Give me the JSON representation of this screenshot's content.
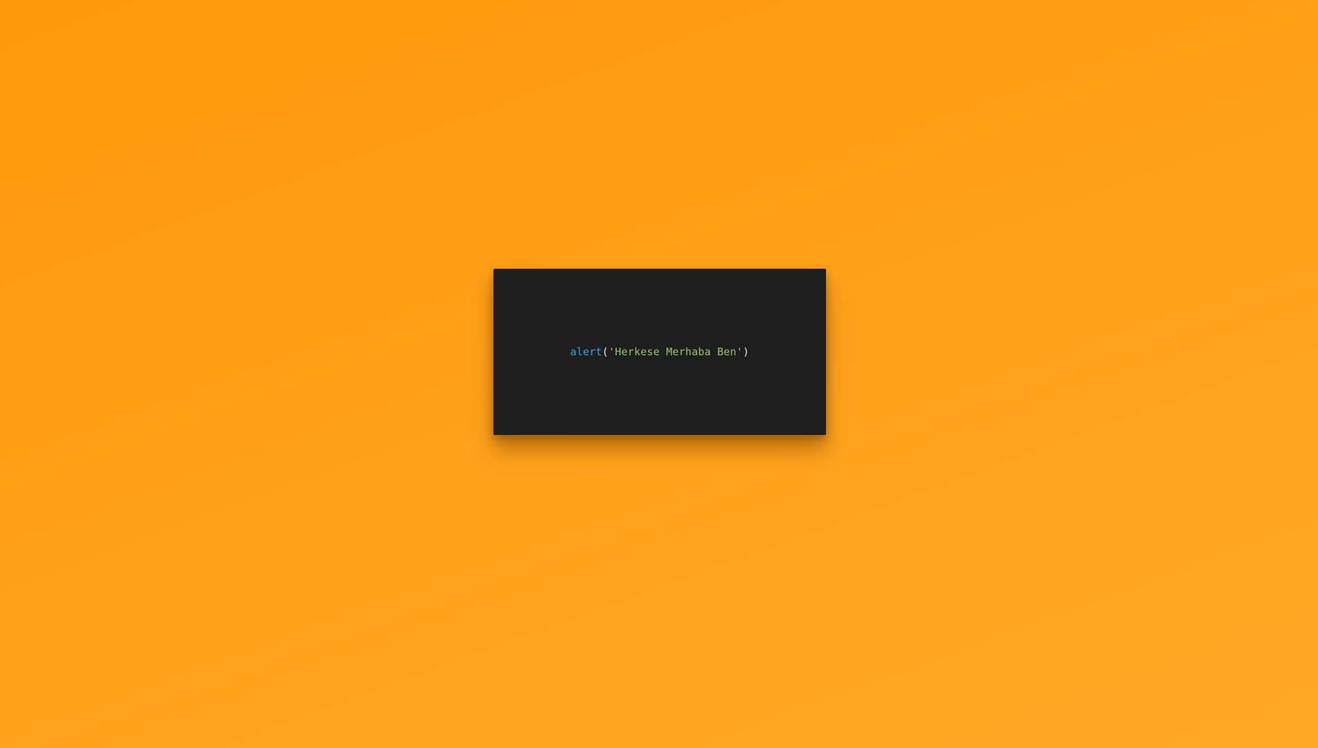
{
  "code_card": {
    "tokens": {
      "function_name": "alert",
      "open_paren": "(",
      "string_literal": "'Herkese Merhaba Ben'",
      "close_paren": ")"
    }
  },
  "colors": {
    "background_start": "#ff9a0c",
    "background_end": "#ffa826",
    "card_background": "#1e1e1e",
    "function_color": "#3aa0e8",
    "punctuation_color": "#e6e6e6",
    "string_color": "#98c46a"
  }
}
